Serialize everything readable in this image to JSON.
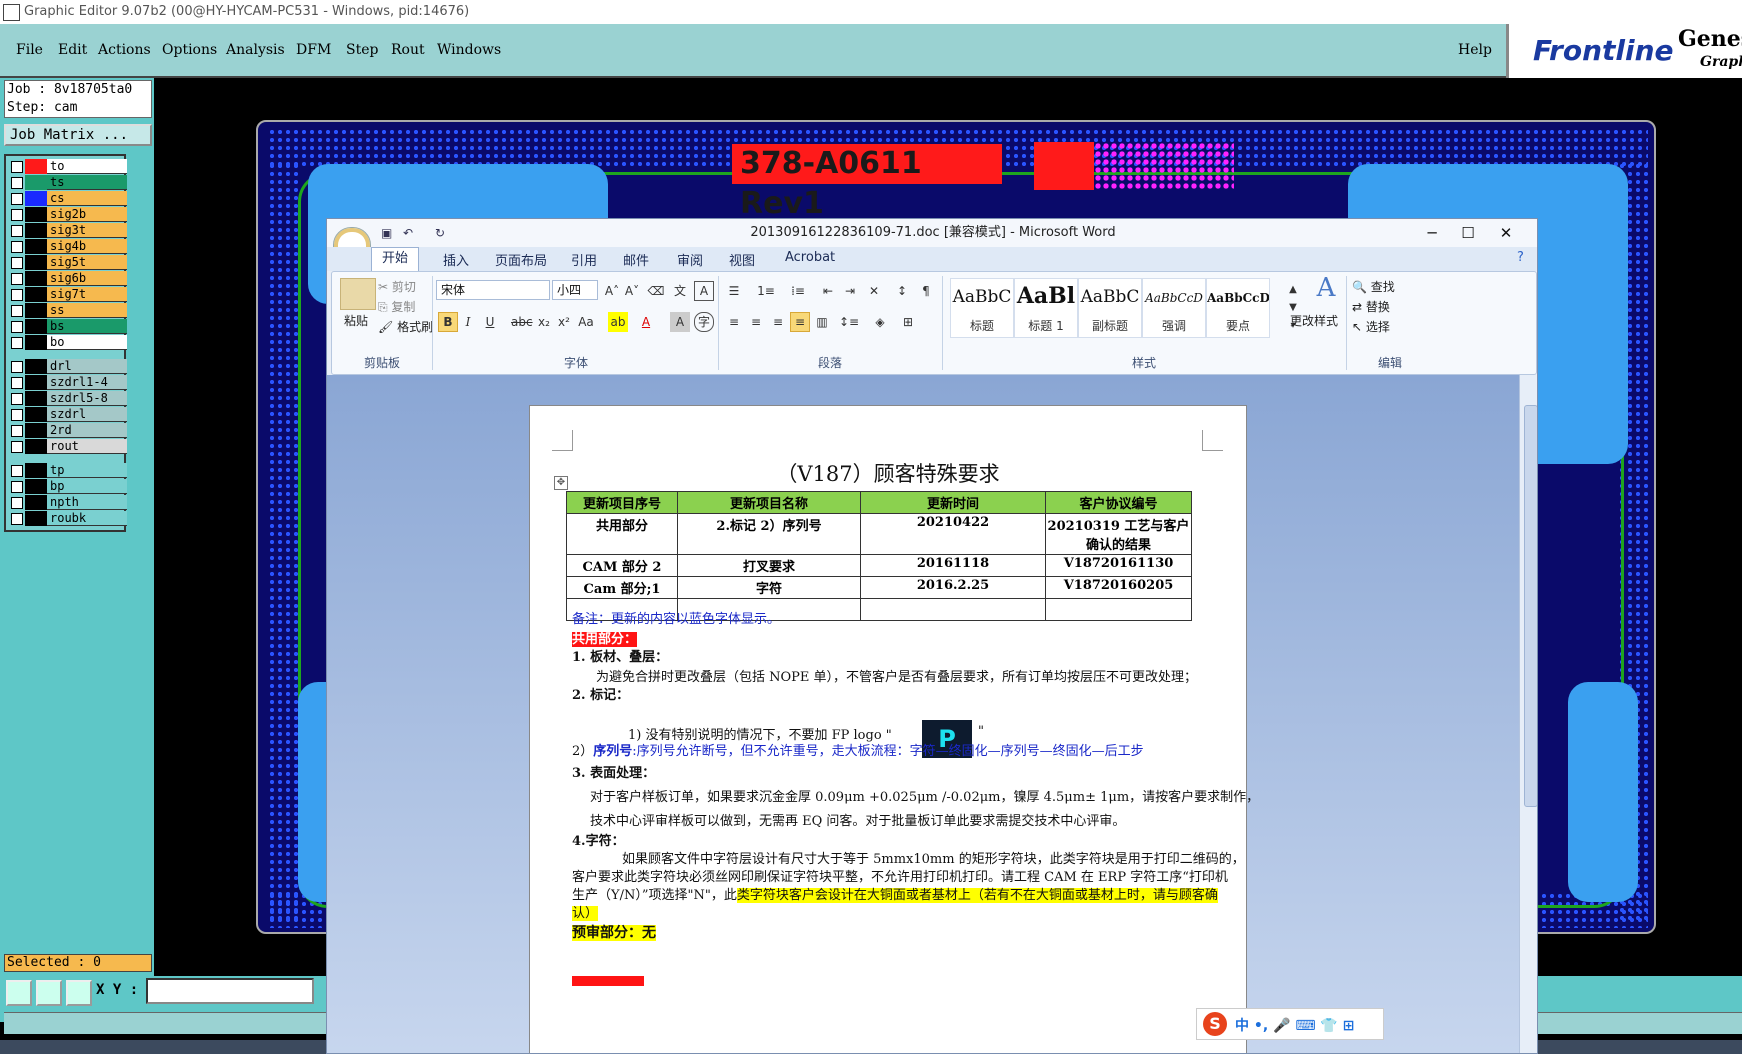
{
  "window": {
    "title": "Graphic Editor 9.07b2 (00@HY-HYCAM-PC531 - Windows, pid:14676)"
  },
  "menu": {
    "items": [
      "File",
      "Edit",
      "Actions",
      "Options",
      "Analysis",
      "DFM",
      "Step",
      "Rout",
      "Windows"
    ],
    "help": "Help"
  },
  "brand": {
    "frontline": "Frontline",
    "genesis": "Genes",
    "graphic": "Graphi"
  },
  "job": {
    "job_line": "Job : 8v18705ta0",
    "step_line": "Step: cam",
    "matrix_button": "Job Matrix ..."
  },
  "layers": [
    {
      "name": "to",
      "color": "#ff1a1a",
      "bg": "#ffffff"
    },
    {
      "name": "ts",
      "color": "#1a9a6a",
      "bg": "#1a9a6a"
    },
    {
      "name": "cs",
      "color": "#1a2aff",
      "bg": "#f6b94e"
    },
    {
      "name": "sig2b",
      "color": "#000000",
      "bg": "#f6b94e"
    },
    {
      "name": "sig3t",
      "color": "#000000",
      "bg": "#f6b94e"
    },
    {
      "name": "sig4b",
      "color": "#000000",
      "bg": "#f6b94e"
    },
    {
      "name": "sig5t",
      "color": "#000000",
      "bg": "#f6b94e"
    },
    {
      "name": "sig6b",
      "color": "#000000",
      "bg": "#f6b94e"
    },
    {
      "name": "sig7t",
      "color": "#000000",
      "bg": "#f6b94e"
    },
    {
      "name": "ss",
      "color": "#000000",
      "bg": "#f6b94e"
    },
    {
      "name": "bs",
      "color": "#000000",
      "bg": "#1a9a6a"
    },
    {
      "name": "bo",
      "color": "#000000",
      "bg": "#ffffff"
    },
    {
      "name": "drl",
      "color": "#000000",
      "bg": "#a4c8c8"
    },
    {
      "name": "szdrl1-4",
      "color": "#000000",
      "bg": "#a4c8c8"
    },
    {
      "name": "szdrl5-8",
      "color": "#000000",
      "bg": "#a4c8c8"
    },
    {
      "name": "szdrl",
      "color": "#000000",
      "bg": "#a4c8c8"
    },
    {
      "name": "2rd",
      "color": "#000000",
      "bg": "#a4c8c8"
    },
    {
      "name": "rout",
      "color": "#000000",
      "bg": "#d9d9d9"
    },
    {
      "name": "tp",
      "color": "#000000",
      "bg": "#7ad0d0"
    },
    {
      "name": "bp",
      "color": "#000000",
      "bg": "#7ad0d0"
    },
    {
      "name": "npth",
      "color": "#000000",
      "bg": "#7ad0d0"
    },
    {
      "name": "roubk",
      "color": "#000000",
      "bg": "#7ad0d0"
    }
  ],
  "status": {
    "selected": "Selected : 0",
    "xy_label": "X Y :"
  },
  "pcb": {
    "title_text": "378-A0611 Rev1"
  },
  "word": {
    "title": "20130916122836109-71.doc [兼容模式] - Microsoft Word",
    "tabs": [
      "开始",
      "插入",
      "页面布局",
      "引用",
      "邮件",
      "审阅",
      "视图",
      "Acrobat"
    ],
    "clipboard": {
      "paste": "粘贴",
      "cut": "剪切",
      "copy": "复制",
      "format_painter": "格式刷",
      "label": "剪贴板"
    },
    "font": {
      "name": "宋体",
      "size": "小四",
      "label": "字体"
    },
    "paragraph": {
      "label": "段落"
    },
    "styles": {
      "items": [
        {
          "sample": "AaBbC",
          "label": "标题"
        },
        {
          "sample": "AaBl",
          "label": "标题 1"
        },
        {
          "sample": "AaBbC",
          "label": "副标题"
        },
        {
          "sample": "AaBbCcD",
          "label": "强调"
        },
        {
          "sample": "AaBbCcD",
          "label": "要点"
        }
      ],
      "change": "更改样式",
      "label": "样式"
    },
    "editing": {
      "find": "查找",
      "replace": "替换",
      "select": "选择",
      "label": "编辑"
    }
  },
  "doc": {
    "title": "（V187）顾客特殊要求",
    "table": {
      "headers": [
        "更新项目序号",
        "更新项目名称",
        "更新时间",
        "客户协议编号"
      ],
      "rows": [
        [
          "共用部分",
          "2.标记 2）序列号",
          "20210422",
          "20210319 工艺与客户确认的结果"
        ],
        [
          "CAM 部分 2",
          "打叉要求",
          "20161118",
          "V18720161130"
        ],
        [
          "Cam 部分;1",
          "字符",
          "2016.2.25",
          "V18720160205"
        ],
        [
          "",
          "",
          "",
          ""
        ]
      ]
    },
    "note": "备注：更新的内容以蓝色字体显示。",
    "section_common": "共用部分：",
    "item1_heading": "1.   板材、叠层：",
    "item1_text": "为避免合拼时更改叠层（包括 NOPE 单），不管客户是否有叠层要求，所有订单均按层压不可更改处理；",
    "item2_heading": "2.  标记：",
    "item2_sub1": "1)   没有特别说明的情况下，不要加 FP logo \"",
    "item2_sub1_end": "\"",
    "fp_logo": "P",
    "item2_sub2_prefix": "2）",
    "item2_sub2_label": "序列号",
    "item2_sub2_text": ":序列号允许断号，但不允许重号，走大板流程：字符—终固化—序列号—终固化—后工步",
    "item3_heading": "3.  表面处理：",
    "item3_line1": "对于客户样板订单，如果要求沉金金厚 0.09μm +0.025μm /-0.02μm，镍厚 4.5μm± 1μm，请按客户要求制作，",
    "item3_line2": "技术中心评审样板可以做到，无需再 EQ 问客。对于批量板订单此要求需提交技术中心评审。",
    "item4_heading": "4.字符：",
    "item4_line1": "如果顾客文件中字符层设计有尺寸大于等于 5mmx10mm 的矩形字符块，此类字符块是用于打印二维码的，",
    "item4_line2": "客户要求此类字符块必须丝网印刷保证字符块平整，不允许用打印机打印。请工程 CAM 在 ERP 字符工序“打印机",
    "item4_line3_plain": "生产（Y/N）”项选择\"N\"，此",
    "item4_line3_yellow": "类字符块客户会设计在大铜面或者基材上（若有不在大铜面或基材上时，请与顾客确",
    "item4_line4_yellow": "认）",
    "preaudit_label": "预审部分：",
    "preaudit_value": "无"
  },
  "ime": {
    "logo": "S",
    "text": "中 •, 🎤 ⌨ 👕 ⊞"
  }
}
